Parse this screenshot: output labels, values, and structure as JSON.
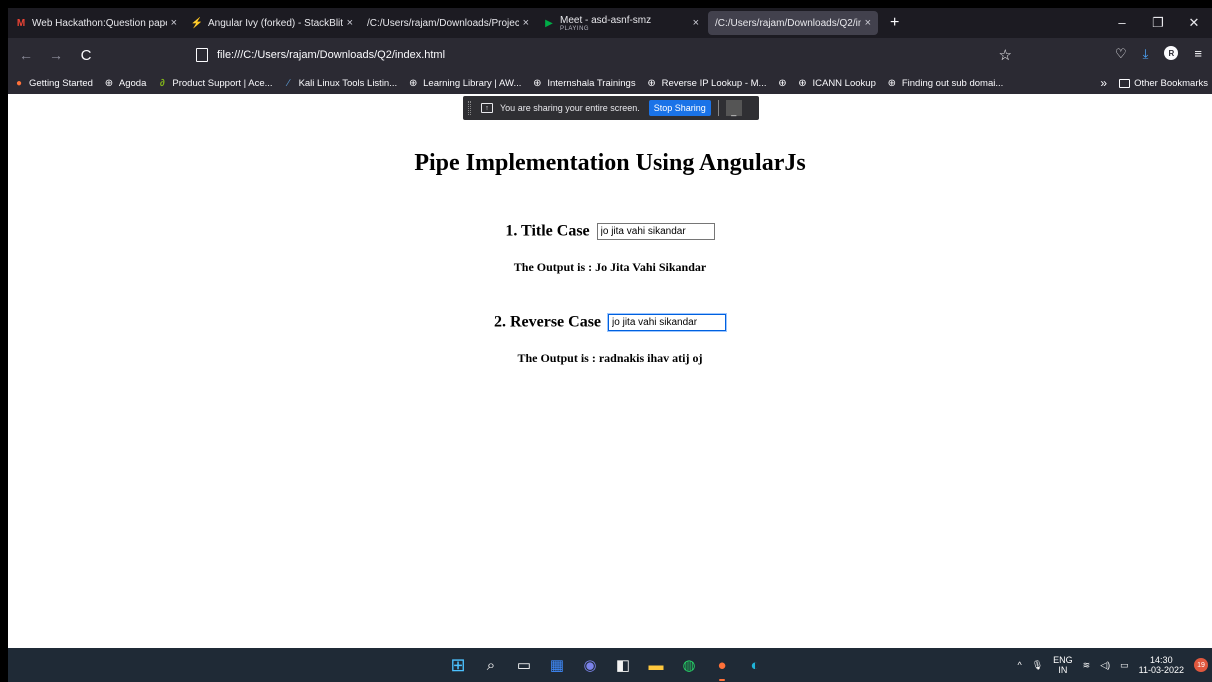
{
  "tabs": [
    {
      "title": "Web Hackathon:Question paper",
      "icon": "gmail-icon",
      "icon_color": "#ea4335"
    },
    {
      "title": "Angular Ivy (forked) - StackBlitz",
      "icon": "stackblitz-icon",
      "icon_color": "#1389fd"
    },
    {
      "title": "/C:/Users/rajam/Downloads/Project",
      "icon": "",
      "icon_color": ""
    },
    {
      "title": "Meet - asd-asnf-smz",
      "subtitle": "PLAYING",
      "icon": "meet-icon",
      "icon_color": "#00ac47"
    },
    {
      "title": "/C:/Users/rajam/Downloads/Q2/ind",
      "icon": "",
      "icon_color": ""
    }
  ],
  "close_glyph": "×",
  "new_tab_glyph": "+",
  "window_controls": {
    "minimize": "–",
    "restore": "❐",
    "close": "✕"
  },
  "navbar": {
    "back": "←",
    "forward": "→",
    "reload": "C",
    "url": "file:///C:/Users/rajam/Downloads/Q2/index.html",
    "star": "☆",
    "pocket": "♡",
    "download": "⤓",
    "account": "R",
    "menu": "≡"
  },
  "bookmarks": [
    {
      "label": "Getting Started",
      "icon": "firefox-icon",
      "glyph": "●",
      "color": "#ff7139"
    },
    {
      "label": "Agoda",
      "icon": "globe-icon",
      "glyph": "⊕",
      "color": "#fbfbfe"
    },
    {
      "label": "Product Support | Ace...",
      "icon": "acer-icon",
      "glyph": "∂",
      "color": "#83b81a"
    },
    {
      "label": "Kali Linux Tools Listin...",
      "icon": "kali-icon",
      "glyph": "∕",
      "color": "#5b9bd5"
    },
    {
      "label": "Learning Library | AW...",
      "icon": "globe-icon",
      "glyph": "⊕",
      "color": "#fbfbfe"
    },
    {
      "label": "Internshala Trainings",
      "icon": "globe-icon",
      "glyph": "⊕",
      "color": "#fbfbfe"
    },
    {
      "label": "Reverse IP Lookup - M...",
      "icon": "globe-icon",
      "glyph": "⊕",
      "color": "#fbfbfe"
    },
    {
      "label": "",
      "icon": "globe-icon",
      "glyph": "⊕",
      "color": "#fbfbfe"
    },
    {
      "label": "ICANN Lookup",
      "icon": "globe-icon",
      "glyph": "⊕",
      "color": "#fbfbfe"
    },
    {
      "label": "Finding out sub domai...",
      "icon": "globe-icon",
      "glyph": "⊕",
      "color": "#fbfbfe"
    }
  ],
  "bookmarks_overflow": "»",
  "other_bookmarks": "Other Bookmarks",
  "share_bar": {
    "message": "You are sharing your entire screen.",
    "stop_label": "Stop Sharing",
    "hide_label": "_"
  },
  "page": {
    "heading": "Pipe Implementation Using AngularJs",
    "title_case": {
      "label": "1. Title Case",
      "input_value": "jo jita vahi sikandar",
      "output": "The Output is : Jo Jita Vahi Sikandar"
    },
    "reverse_case": {
      "label": "2. Reverse Case",
      "input_value": "jo jita vahi sikandar",
      "output": "The Output is : radnakis ihav atij oj"
    }
  },
  "taskbar": {
    "apps": [
      {
        "name": "start-icon",
        "glyph": "⊞",
        "color": "#4cc2ff"
      },
      {
        "name": "search-icon",
        "glyph": "⌕",
        "color": "#ffffff"
      },
      {
        "name": "task-view-icon",
        "glyph": "▭",
        "color": "#ffffff"
      },
      {
        "name": "widgets-icon",
        "glyph": "▦",
        "color": "#3f8cff"
      },
      {
        "name": "teams-chat-icon",
        "glyph": "◉",
        "color": "#7b83eb"
      },
      {
        "name": "store-icon",
        "glyph": "◧",
        "color": "#f3f3f3"
      },
      {
        "name": "file-explorer-icon",
        "glyph": "▬",
        "color": "#ffc83d"
      },
      {
        "name": "whatsapp-icon",
        "glyph": "◍",
        "color": "#25d366"
      },
      {
        "name": "firefox-taskbar-icon",
        "glyph": "●",
        "color": "#ff7139"
      },
      {
        "name": "edge-icon",
        "glyph": "◐",
        "color": "#1fb4d8"
      }
    ],
    "tray_chevron": "^",
    "mic": "🎙",
    "lang_top": "ENG",
    "lang_bottom": "IN",
    "wifi": "≋",
    "volume": "◁)",
    "battery": "▭",
    "time": "14:30",
    "date": "11-03-2022",
    "notification_count": "19"
  }
}
